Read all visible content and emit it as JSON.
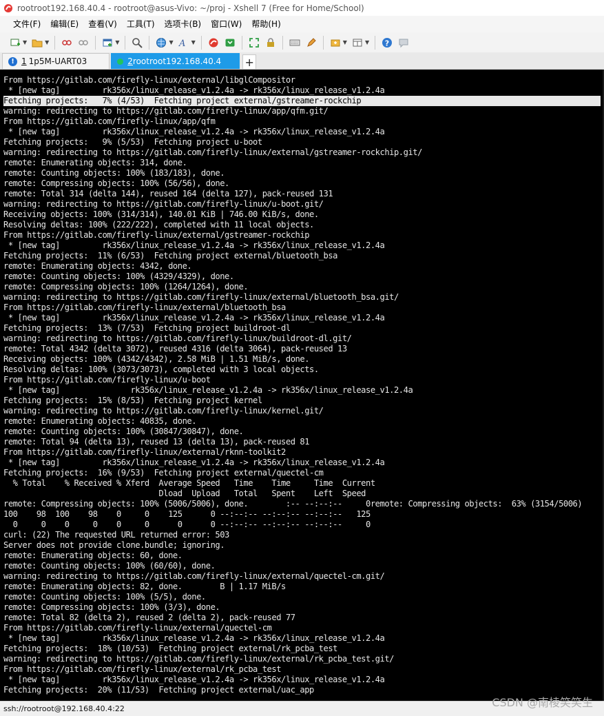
{
  "window": {
    "title": "rootroot192.168.40.4 - rootroot@asus-Vivo: ~/proj - Xshell 7 (Free for Home/School)"
  },
  "menu": {
    "items": [
      "文件(F)",
      "编辑(E)",
      "查看(V)",
      "工具(T)",
      "选项卡(B)",
      "窗口(W)",
      "帮助(H)"
    ]
  },
  "toolbar": {
    "icons": [
      "new-session-icon",
      "open-folder-icon",
      "link-icon",
      "unlink-icon",
      "new-tab-icon",
      "search-icon",
      "globe-icon",
      "font-icon",
      "xshell-icon",
      "xftp-icon",
      "fullscreen-icon",
      "lock-icon",
      "keyboard-icon",
      "pen-icon",
      "compose-icon",
      "layout-icon",
      "help-icon",
      "chat-icon"
    ]
  },
  "tabs": [
    {
      "num": "1",
      "label": "1p5M-UART03",
      "active": false,
      "status": "warning"
    },
    {
      "num": "2",
      "label": "rootroot192.168.40.4",
      "active": true,
      "status": "connected"
    }
  ],
  "add_tab": "+",
  "terminal": {
    "highlight_index": 2,
    "lines": [
      "From https://gitlab.com/firefly-linux/external/libglCompositor",
      " * [new tag]         rk356x/linux_release_v1.2.4a -> rk356x/linux_release_v1.2.4a",
      "Fetching projects:   7% (4/53)  Fetching project external/gstreamer-rockchip",
      "warning: redirecting to https://gitlab.com/firefly-linux/app/qfm.git/",
      "From https://gitlab.com/firefly-linux/app/qfm",
      " * [new tag]         rk356x/linux_release_v1.2.4a -> rk356x/linux_release_v1.2.4a",
      "Fetching projects:   9% (5/53)  Fetching project u-boot",
      "warning: redirecting to https://gitlab.com/firefly-linux/external/gstreamer-rockchip.git/",
      "remote: Enumerating objects: 314, done.",
      "remote: Counting objects: 100% (183/183), done.",
      "remote: Compressing objects: 100% (56/56), done.",
      "remote: Total 314 (delta 144), reused 164 (delta 127), pack-reused 131",
      "warning: redirecting to https://gitlab.com/firefly-linux/u-boot.git/",
      "Receiving objects: 100% (314/314), 140.01 KiB | 746.00 KiB/s, done.",
      "Resolving deltas: 100% (222/222), completed with 11 local objects.",
      "From https://gitlab.com/firefly-linux/external/gstreamer-rockchip",
      " * [new tag]         rk356x/linux_release_v1.2.4a -> rk356x/linux_release_v1.2.4a",
      "Fetching projects:  11% (6/53)  Fetching project external/bluetooth_bsa",
      "remote: Enumerating objects: 4342, done.",
      "remote: Counting objects: 100% (4329/4329), done.",
      "remote: Compressing objects: 100% (1264/1264), done.",
      "warning: redirecting to https://gitlab.com/firefly-linux/external/bluetooth_bsa.git/",
      "From https://gitlab.com/firefly-linux/external/bluetooth_bsa",
      " * [new tag]         rk356x/linux_release_v1.2.4a -> rk356x/linux_release_v1.2.4a",
      "Fetching projects:  13% (7/53)  Fetching project buildroot-dl",
      "warning: redirecting to https://gitlab.com/firefly-linux/buildroot-dl.git/",
      "remote: Total 4342 (delta 3072), reused 4316 (delta 3064), pack-reused 13",
      "Receiving objects: 100% (4342/4342), 2.58 MiB | 1.51 MiB/s, done.",
      "Resolving deltas: 100% (3073/3073), completed with 3 local objects.",
      "From https://gitlab.com/firefly-linux/u-boot",
      " * [new tag]               rk356x/linux_release_v1.2.4a -> rk356x/linux_release_v1.2.4a",
      "Fetching projects:  15% (8/53)  Fetching project kernel",
      "warning: redirecting to https://gitlab.com/firefly-linux/kernel.git/",
      "remote: Enumerating objects: 40835, done.",
      "remote: Counting objects: 100% (30847/30847), done.",
      "remote: Total 94 (delta 13), reused 13 (delta 13), pack-reused 81",
      "From https://gitlab.com/firefly-linux/external/rknn-toolkit2",
      " * [new tag]         rk356x/linux_release_v1.2.4a -> rk356x/linux_release_v1.2.4a",
      "Fetching projects:  16% (9/53)  Fetching project external/quectel-cm",
      "  % Total    % Received % Xferd  Average Speed   Time    Time     Time  Current",
      "                                 Dload  Upload   Total   Spent    Left  Speed",
      "remote: Compressing objects: 100% (5006/5006), done.        :-- --:--:--     0remote: Compressing objects:  63% (3154/5006)",
      "100    98  100    98    0     0    125      0 --:--:-- --:--:-- --:--:--   125",
      "  0     0    0     0    0     0      0      0 --:--:-- --:--:-- --:--:--     0",
      "curl: (22) The requested URL returned error: 503",
      "Server does not provide clone.bundle; ignoring.",
      "remote: Enumerating objects: 60, done.",
      "remote: Counting objects: 100% (60/60), done.",
      "warning: redirecting to https://gitlab.com/firefly-linux/external/quectel-cm.git/",
      "remote: Enumerating objects: 82, done.        B | 1.17 MiB/s",
      "remote: Counting objects: 100% (5/5), done.",
      "remote: Compressing objects: 100% (3/3), done.",
      "remote: Total 82 (delta 2), reused 2 (delta 2), pack-reused 77",
      "From https://gitlab.com/firefly-linux/external/quectel-cm",
      " * [new tag]         rk356x/linux_release_v1.2.4a -> rk356x/linux_release_v1.2.4a",
      "Fetching projects:  18% (10/53)  Fetching project external/rk_pcba_test",
      "warning: redirecting to https://gitlab.com/firefly-linux/external/rk_pcba_test.git/",
      "From https://gitlab.com/firefly-linux/external/rk_pcba_test",
      " * [new tag]         rk356x/linux_release_v1.2.4a -> rk356x/linux_release_v1.2.4a",
      "Fetching projects:  20% (11/53)  Fetching project external/uac_app"
    ]
  },
  "status": {
    "connection": "ssh://rootroot@192.168.40.4:22"
  },
  "watermark": "CSDN @南棱笑笑生",
  "colors": {
    "terminal_bg": "#000000",
    "terminal_fg": "#e6e6e6",
    "active_tab": "#1e9be8",
    "highlight_bg": "#e8e8e8"
  }
}
